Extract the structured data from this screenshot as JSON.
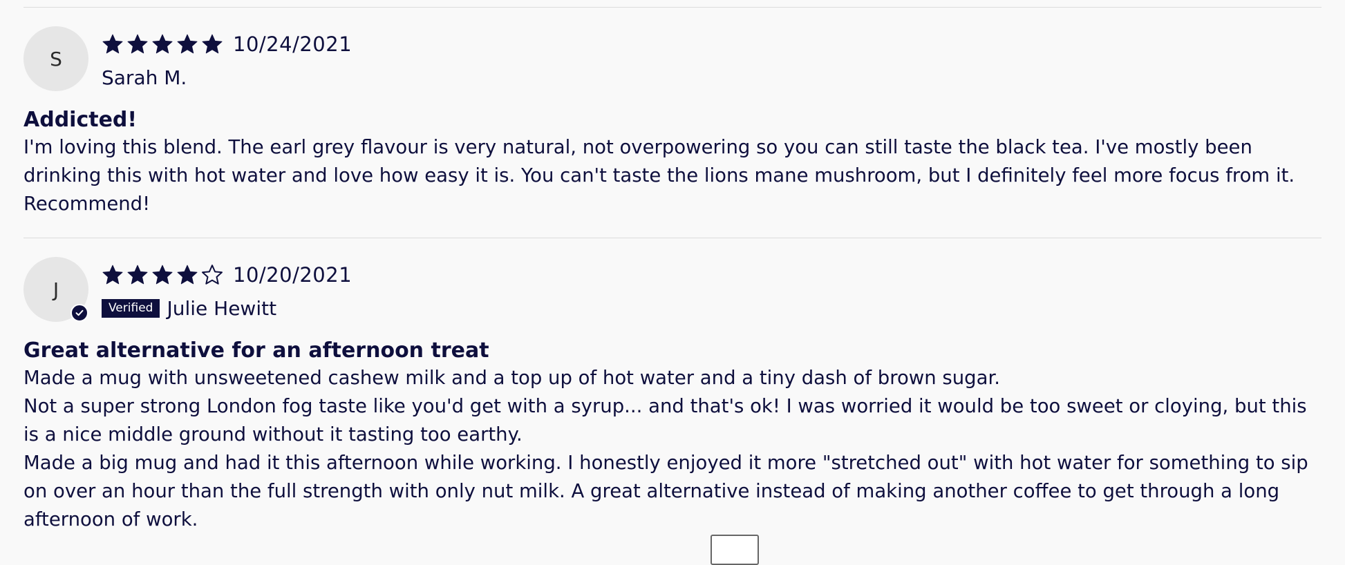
{
  "reviews": [
    {
      "avatar_initial": "S",
      "rating": 5,
      "max_rating": 5,
      "date": "10/24/2021",
      "verified": false,
      "author": "Sarah M.",
      "title": "Addicted!",
      "body": [
        "I'm loving this blend. The earl grey flavour is very natural, not overpowering so you can still taste the black tea. I've mostly been drinking this with hot water and love how easy it is. You can't taste the lions mane mushroom, but I definitely feel more focus from it. Recommend!"
      ]
    },
    {
      "avatar_initial": "J",
      "rating": 4,
      "max_rating": 5,
      "date": "10/20/2021",
      "verified": true,
      "verified_label": "Verified",
      "author": "Julie Hewitt",
      "title": "Great alternative for an afternoon treat",
      "body": [
        "Made a mug with unsweetened cashew milk and a top up of hot water and a tiny dash of brown sugar.",
        "Not a super strong London fog taste like you'd get with a syrup... and that's ok! I was worried it would be too sweet or cloying, but this is a nice middle ground without it tasting too earthy.",
        "Made a big mug and had it this afternoon while working. I honestly enjoyed it more \"stretched out\" with hot water for something to sip on over an hour than the full strength with only nut milk. A great alternative instead of making another coffee to get through a long afternoon of work."
      ]
    }
  ],
  "colors": {
    "primary": "#0e0f3d",
    "avatar_bg": "#e6e6e6",
    "divider": "#dcdcdc",
    "page_bg": "#f9f9f9"
  },
  "icons": {
    "star_filled": "star-filled-icon",
    "star_empty": "star-outline-icon",
    "verified_check": "check-icon"
  }
}
